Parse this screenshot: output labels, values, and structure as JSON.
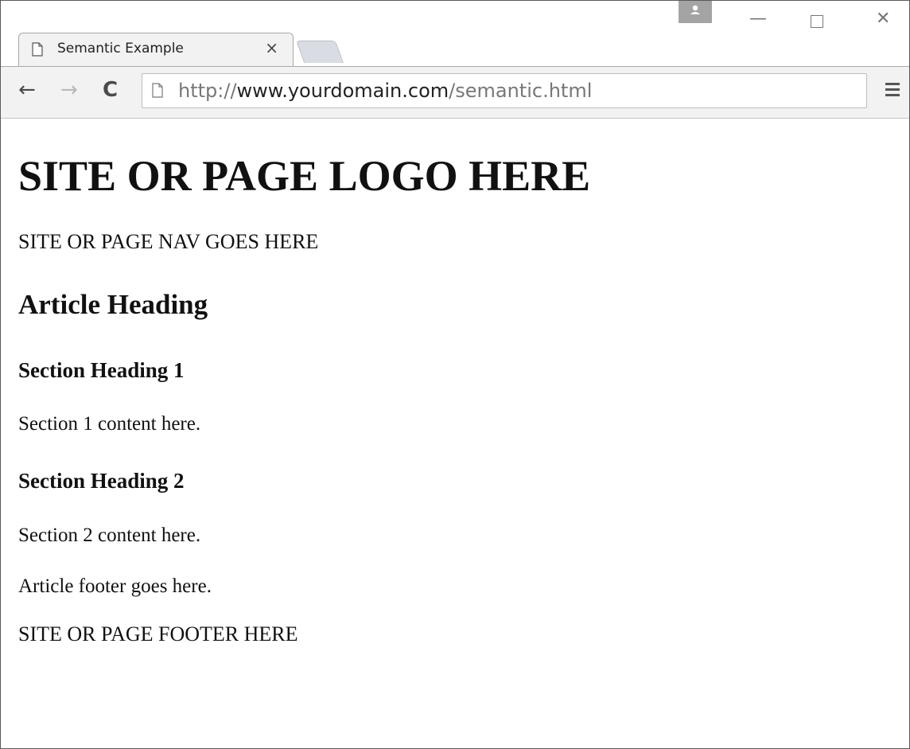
{
  "browser": {
    "tab": {
      "title": "Semantic Example",
      "close_glyph": "×",
      "icon": "page-icon"
    },
    "window_controls": {
      "minimize_glyph": "—",
      "close_glyph": "✕"
    },
    "toolbar": {
      "back_glyph": "←",
      "forward_glyph": "→",
      "reload_glyph": "C",
      "url_scheme": "http://",
      "url_host": "www.yourdomain.com",
      "url_path": "/semantic.html",
      "menu_icon": "hamburger-menu-icon"
    }
  },
  "page": {
    "logo": "SITE OR PAGE LOGO HERE",
    "nav": "SITE OR PAGE NAV GOES HERE",
    "article_heading": "Article Heading",
    "sections": [
      {
        "heading": "Section Heading 1",
        "content": "Section 1 content here."
      },
      {
        "heading": "Section Heading 2",
        "content": "Section 2 content here."
      }
    ],
    "article_footer": "Article footer goes here.",
    "site_footer": "SITE OR PAGE FOOTER HERE"
  },
  "colors": {
    "toolbar_bg": "#f2f2f2",
    "text": "#111111",
    "url_dim": "#777777"
  }
}
